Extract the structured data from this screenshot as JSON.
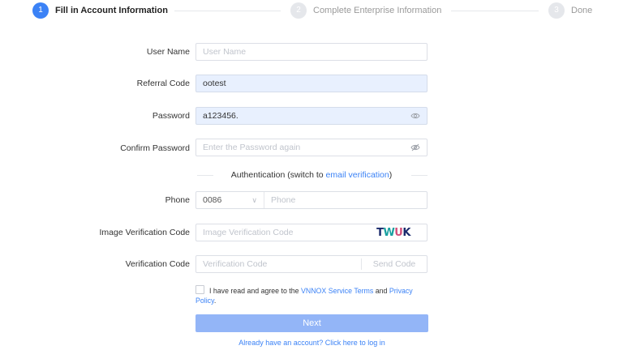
{
  "steps": [
    {
      "num": "1",
      "label": "Fill in Account Information"
    },
    {
      "num": "2",
      "label": "Complete Enterprise Information"
    },
    {
      "num": "3",
      "label": "Done"
    }
  ],
  "form": {
    "username": {
      "label": "User Name",
      "value": "",
      "placeholder": "User Name"
    },
    "referral": {
      "label": "Referral Code",
      "value": "ootest",
      "placeholder": ""
    },
    "password": {
      "label": "Password",
      "value": "a123456.",
      "placeholder": ""
    },
    "confirm": {
      "label": "Confirm Password",
      "value": "",
      "placeholder": "Enter the Password again"
    },
    "auth": {
      "prefix": "Authentication (switch to ",
      "link": "email verification",
      "suffix": ")"
    },
    "phone": {
      "label": "Phone",
      "country_code": "0086",
      "value": "",
      "placeholder": "Phone"
    },
    "image_code": {
      "label": "Image Verification Code",
      "value": "",
      "placeholder": "Image Verification Code",
      "captcha_text": "TWUK"
    },
    "verification": {
      "label": "Verification Code",
      "value": "",
      "placeholder": "Verification Code",
      "send_label": "Send Code"
    }
  },
  "agreement": {
    "prefix": "I have read and agree to the ",
    "terms": "VNNOX Service Terms",
    "and": " and ",
    "privacy": "Privacy Policy",
    "suffix": "."
  },
  "next_label": "Next",
  "login_link": "Already have an account? Click here to log in",
  "icons": {
    "password_toggle": "eye-icon",
    "confirm_toggle": "eye-off-icon",
    "phone_dropdown": "chevron-down-icon"
  },
  "colors": {
    "primary": "#3b82f6",
    "button_disabled": "#93b5f7",
    "autofill_bg": "#e8f0fe",
    "captcha": [
      "#1a2a6c",
      "#19a0a0",
      "#d24f7a",
      "#1a2a6c"
    ]
  }
}
